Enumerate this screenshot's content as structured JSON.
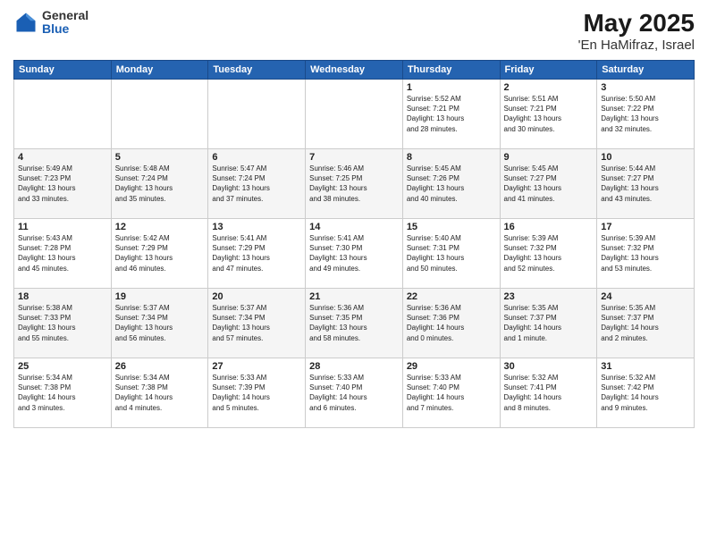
{
  "logo": {
    "general": "General",
    "blue": "Blue"
  },
  "header": {
    "month": "May 2025",
    "location": "'En HaMifraz, Israel"
  },
  "weekdays": [
    "Sunday",
    "Monday",
    "Tuesday",
    "Wednesday",
    "Thursday",
    "Friday",
    "Saturday"
  ],
  "weeks": [
    [
      {
        "day": "",
        "info": ""
      },
      {
        "day": "",
        "info": ""
      },
      {
        "day": "",
        "info": ""
      },
      {
        "day": "",
        "info": ""
      },
      {
        "day": "1",
        "info": "Sunrise: 5:52 AM\nSunset: 7:21 PM\nDaylight: 13 hours\nand 28 minutes."
      },
      {
        "day": "2",
        "info": "Sunrise: 5:51 AM\nSunset: 7:21 PM\nDaylight: 13 hours\nand 30 minutes."
      },
      {
        "day": "3",
        "info": "Sunrise: 5:50 AM\nSunset: 7:22 PM\nDaylight: 13 hours\nand 32 minutes."
      }
    ],
    [
      {
        "day": "4",
        "info": "Sunrise: 5:49 AM\nSunset: 7:23 PM\nDaylight: 13 hours\nand 33 minutes."
      },
      {
        "day": "5",
        "info": "Sunrise: 5:48 AM\nSunset: 7:24 PM\nDaylight: 13 hours\nand 35 minutes."
      },
      {
        "day": "6",
        "info": "Sunrise: 5:47 AM\nSunset: 7:24 PM\nDaylight: 13 hours\nand 37 minutes."
      },
      {
        "day": "7",
        "info": "Sunrise: 5:46 AM\nSunset: 7:25 PM\nDaylight: 13 hours\nand 38 minutes."
      },
      {
        "day": "8",
        "info": "Sunrise: 5:45 AM\nSunset: 7:26 PM\nDaylight: 13 hours\nand 40 minutes."
      },
      {
        "day": "9",
        "info": "Sunrise: 5:45 AM\nSunset: 7:27 PM\nDaylight: 13 hours\nand 41 minutes."
      },
      {
        "day": "10",
        "info": "Sunrise: 5:44 AM\nSunset: 7:27 PM\nDaylight: 13 hours\nand 43 minutes."
      }
    ],
    [
      {
        "day": "11",
        "info": "Sunrise: 5:43 AM\nSunset: 7:28 PM\nDaylight: 13 hours\nand 45 minutes."
      },
      {
        "day": "12",
        "info": "Sunrise: 5:42 AM\nSunset: 7:29 PM\nDaylight: 13 hours\nand 46 minutes."
      },
      {
        "day": "13",
        "info": "Sunrise: 5:41 AM\nSunset: 7:29 PM\nDaylight: 13 hours\nand 47 minutes."
      },
      {
        "day": "14",
        "info": "Sunrise: 5:41 AM\nSunset: 7:30 PM\nDaylight: 13 hours\nand 49 minutes."
      },
      {
        "day": "15",
        "info": "Sunrise: 5:40 AM\nSunset: 7:31 PM\nDaylight: 13 hours\nand 50 minutes."
      },
      {
        "day": "16",
        "info": "Sunrise: 5:39 AM\nSunset: 7:32 PM\nDaylight: 13 hours\nand 52 minutes."
      },
      {
        "day": "17",
        "info": "Sunrise: 5:39 AM\nSunset: 7:32 PM\nDaylight: 13 hours\nand 53 minutes."
      }
    ],
    [
      {
        "day": "18",
        "info": "Sunrise: 5:38 AM\nSunset: 7:33 PM\nDaylight: 13 hours\nand 55 minutes."
      },
      {
        "day": "19",
        "info": "Sunrise: 5:37 AM\nSunset: 7:34 PM\nDaylight: 13 hours\nand 56 minutes."
      },
      {
        "day": "20",
        "info": "Sunrise: 5:37 AM\nSunset: 7:34 PM\nDaylight: 13 hours\nand 57 minutes."
      },
      {
        "day": "21",
        "info": "Sunrise: 5:36 AM\nSunset: 7:35 PM\nDaylight: 13 hours\nand 58 minutes."
      },
      {
        "day": "22",
        "info": "Sunrise: 5:36 AM\nSunset: 7:36 PM\nDaylight: 14 hours\nand 0 minutes."
      },
      {
        "day": "23",
        "info": "Sunrise: 5:35 AM\nSunset: 7:37 PM\nDaylight: 14 hours\nand 1 minute."
      },
      {
        "day": "24",
        "info": "Sunrise: 5:35 AM\nSunset: 7:37 PM\nDaylight: 14 hours\nand 2 minutes."
      }
    ],
    [
      {
        "day": "25",
        "info": "Sunrise: 5:34 AM\nSunset: 7:38 PM\nDaylight: 14 hours\nand 3 minutes."
      },
      {
        "day": "26",
        "info": "Sunrise: 5:34 AM\nSunset: 7:38 PM\nDaylight: 14 hours\nand 4 minutes."
      },
      {
        "day": "27",
        "info": "Sunrise: 5:33 AM\nSunset: 7:39 PM\nDaylight: 14 hours\nand 5 minutes."
      },
      {
        "day": "28",
        "info": "Sunrise: 5:33 AM\nSunset: 7:40 PM\nDaylight: 14 hours\nand 6 minutes."
      },
      {
        "day": "29",
        "info": "Sunrise: 5:33 AM\nSunset: 7:40 PM\nDaylight: 14 hours\nand 7 minutes."
      },
      {
        "day": "30",
        "info": "Sunrise: 5:32 AM\nSunset: 7:41 PM\nDaylight: 14 hours\nand 8 minutes."
      },
      {
        "day": "31",
        "info": "Sunrise: 5:32 AM\nSunset: 7:42 PM\nDaylight: 14 hours\nand 9 minutes."
      }
    ]
  ]
}
